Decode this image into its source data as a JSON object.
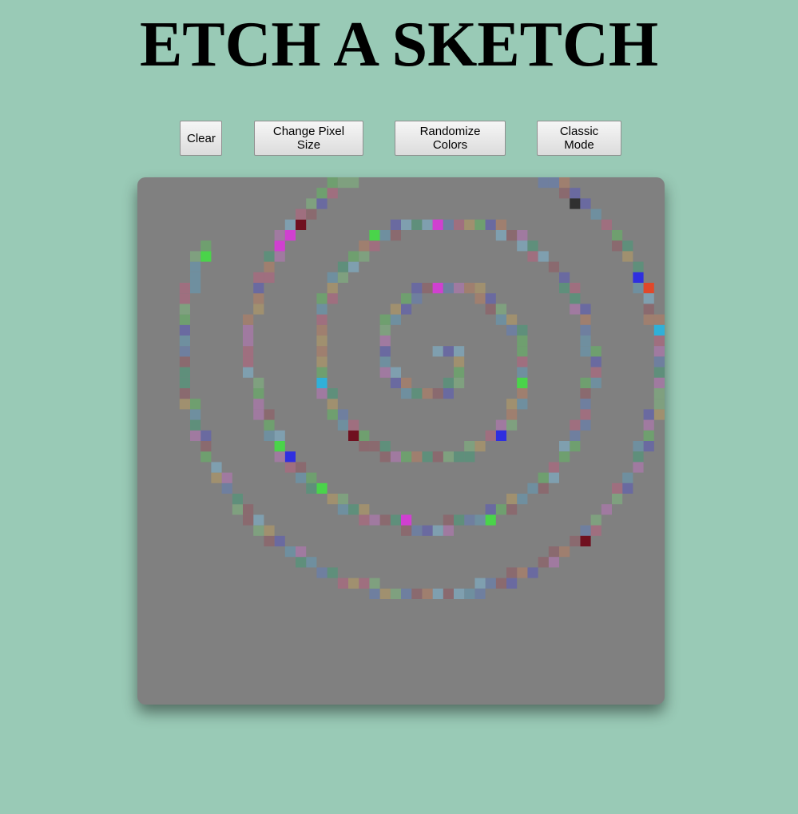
{
  "page": {
    "title": "ETCH A SKETCH"
  },
  "controls": {
    "clear_label": "Clear",
    "pixel_size_label": "Change Pixel Size",
    "randomize_label": "Randomize Colors",
    "classic_label": "Classic Mode"
  },
  "colors": {
    "background": "#99cab6",
    "board": "#808080",
    "cell_palette": [
      "#5f8f7b",
      "#8a6a6f",
      "#6a6aa0",
      "#a07aa0",
      "#6f9f6f",
      "#9f7f6f",
      "#7f9faf",
      "#6f7f9f",
      "#9f6f7f",
      "#7fa07f",
      "#a0906f",
      "#6f8f9f"
    ]
  }
}
